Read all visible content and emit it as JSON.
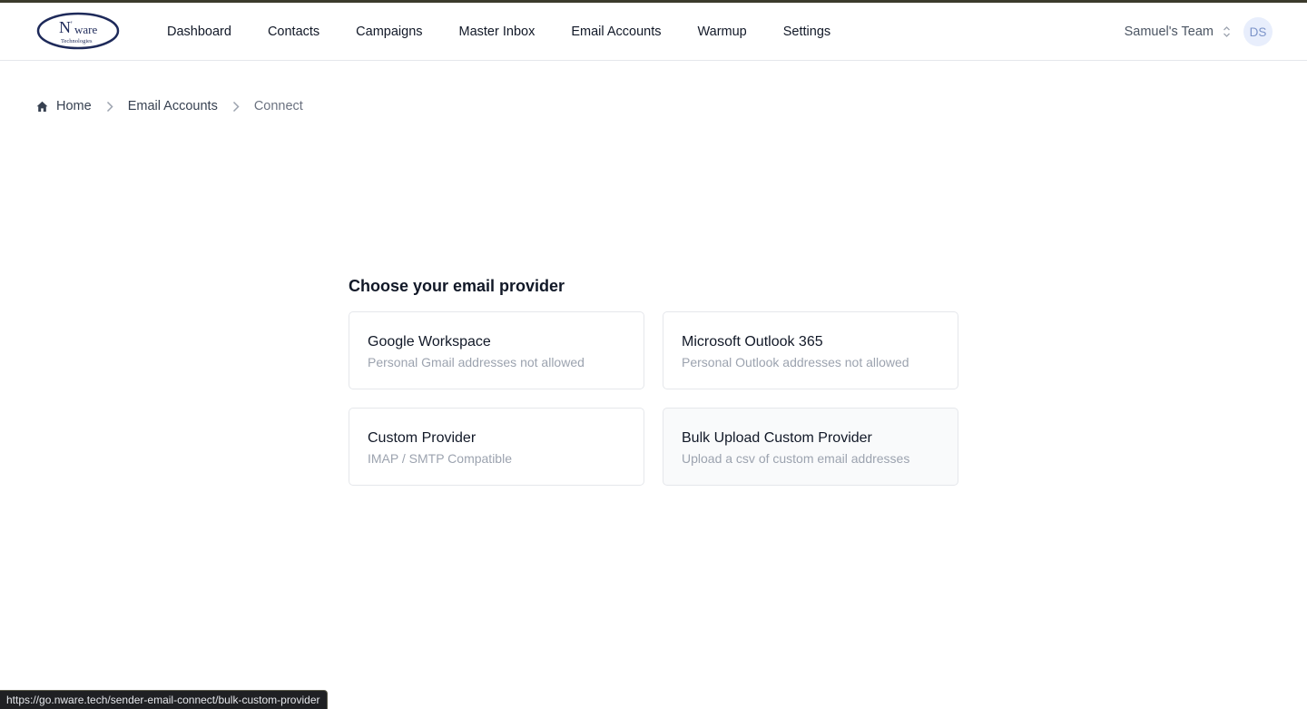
{
  "brand": {
    "logo_text_main": "N'ware",
    "logo_text_sub": "Technologies"
  },
  "nav": {
    "items": [
      {
        "label": "Dashboard"
      },
      {
        "label": "Contacts"
      },
      {
        "label": "Campaigns"
      },
      {
        "label": "Master Inbox"
      },
      {
        "label": "Email Accounts"
      },
      {
        "label": "Warmup"
      },
      {
        "label": "Settings"
      }
    ],
    "team_label": "Samuel's Team",
    "avatar_initials": "DS"
  },
  "breadcrumb": {
    "home": "Home",
    "section": "Email Accounts",
    "current": "Connect"
  },
  "main": {
    "heading": "Choose your email provider",
    "providers": [
      {
        "title": "Google Workspace",
        "subtitle": "Personal Gmail addresses not allowed"
      },
      {
        "title": "Microsoft Outlook 365",
        "subtitle": "Personal Outlook addresses not allowed"
      },
      {
        "title": "Custom Provider",
        "subtitle": "IMAP / SMTP Compatible"
      },
      {
        "title": "Bulk Upload Custom Provider",
        "subtitle": "Upload a csv of custom email addresses"
      }
    ]
  },
  "status_url": "https://go.nware.tech/sender-email-connect/bulk-custom-provider",
  "colors": {
    "accent_strip": "#3b3a2c",
    "logo_blue": "#1e2a5a",
    "avatar_bg": "#e8eefc"
  },
  "icons": [
    "home-icon",
    "chevron-right-icon",
    "chevron-up-down-icon"
  ]
}
